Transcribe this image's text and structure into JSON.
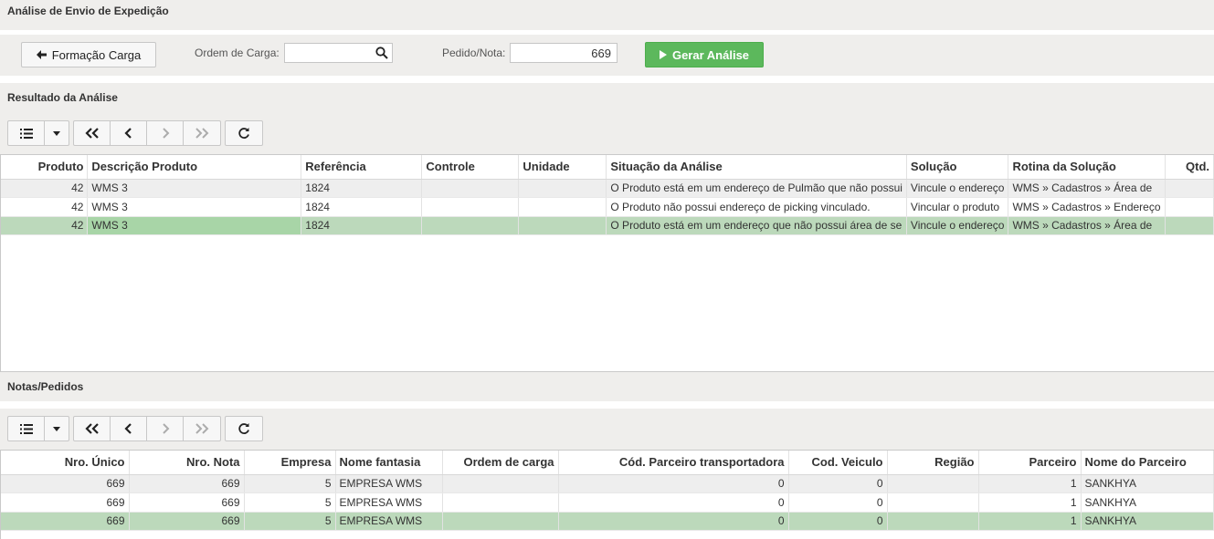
{
  "page": {
    "title": "Análise de Envio de Expedição"
  },
  "filters": {
    "back_button": "Formação Carga",
    "ordem_label": "Ordem de Carga:",
    "ordem_value": "",
    "pedido_label": "Pedido/Nota:",
    "pedido_value": "669",
    "run_button": "Gerar Análise"
  },
  "resultado": {
    "title": "Resultado da Análise",
    "columns": [
      "Produto",
      "Descrição Produto",
      "Referência",
      "Controle",
      "Unidade",
      "Situação da Análise",
      "Solução",
      "Rotina da Solução",
      "Qtd."
    ],
    "rows": [
      [
        "42",
        "WMS 3",
        "1824",
        "",
        "",
        "O Produto está em um endereço de Pulmão que não possui",
        "Vincule o endereço",
        "WMS » Cadastros » Área de",
        ""
      ],
      [
        "42",
        "WMS 3",
        "1824",
        "",
        "",
        "O Produto não possui endereço de picking vinculado.",
        "Vincular o produto",
        "WMS » Cadastros » Endereço",
        ""
      ],
      [
        "42",
        "WMS 3",
        "1824",
        "",
        "",
        "O Produto está em um endereço que não possui área de se",
        "Vincule o endereço",
        "WMS » Cadastros » Área de",
        ""
      ]
    ]
  },
  "notas": {
    "title": "Notas/Pedidos",
    "columns": [
      "Nro. Único",
      "Nro. Nota",
      "Empresa",
      "Nome fantasia",
      "Ordem de carga",
      "Cód. Parceiro transportadora",
      "Cod. Veiculo",
      "Região",
      "Parceiro",
      "Nome do Parceiro"
    ],
    "rows": [
      [
        "669",
        "669",
        "5",
        "EMPRESA WMS",
        "",
        "0",
        "0",
        "",
        "1",
        "SANKHYA"
      ],
      [
        "669",
        "669",
        "5",
        "EMPRESA WMS",
        "",
        "0",
        "0",
        "",
        "1",
        "SANKHYA"
      ],
      [
        "669",
        "669",
        "5",
        "EMPRESA WMS",
        "",
        "0",
        "0",
        "",
        "1",
        "SANKHYA"
      ]
    ]
  },
  "colors": {
    "accent_green": "#5cb85c",
    "selected_row": "#bcd9bb"
  }
}
